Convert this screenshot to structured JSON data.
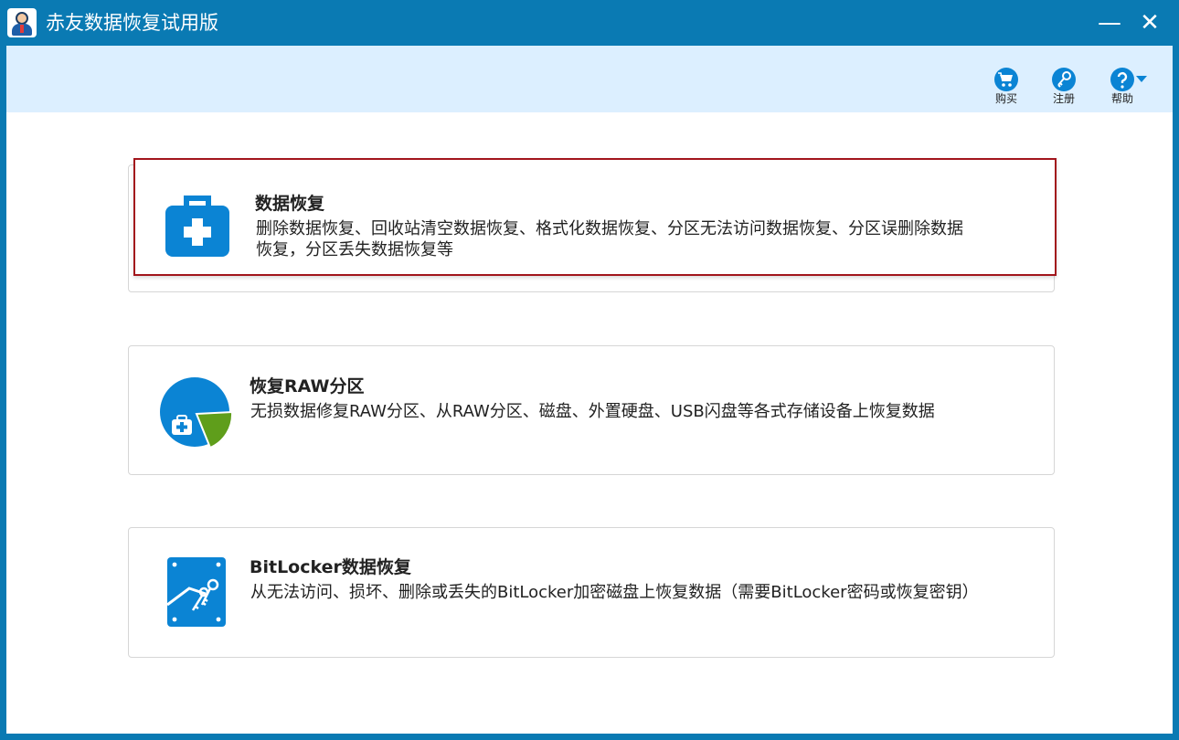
{
  "window": {
    "title": "赤友数据恢复试用版",
    "minimize_glyph": "—",
    "close_glyph": "✕"
  },
  "toolbar": {
    "buy_label": "购买",
    "register_label": "注册",
    "help_label": "帮助",
    "buy_icon": "cart-icon",
    "register_icon": "key-icon",
    "help_icon": "question-icon"
  },
  "cards": [
    {
      "title": "数据恢复",
      "description": "删除数据恢复、回收站清空数据恢复、格式化数据恢复、分区无法访问数据恢复、分区误删除数据恢复，分区丢失数据恢复等",
      "icon": "first-aid-kit-icon"
    },
    {
      "title": "恢复RAW分区",
      "description": "无损数据修复RAW分区、从RAW分区、磁盘、外置硬盘、USB闪盘等各式存储设备上恢复数据",
      "icon": "partition-pie-icon"
    },
    {
      "title": "BitLocker数据恢复",
      "description": "从无法访问、损坏、删除或丢失的BitLocker加密磁盘上恢复数据（需要BitLocker密码或恢复密钥）",
      "icon": "bitlocker-drive-key-icon"
    }
  ],
  "colors": {
    "frame": "#0a7ab3",
    "toolbar_bg": "#dcefff",
    "accent_icon": "#0b84d4",
    "selected_border": "#a2151c",
    "pie_green": "#5f9e1b"
  }
}
